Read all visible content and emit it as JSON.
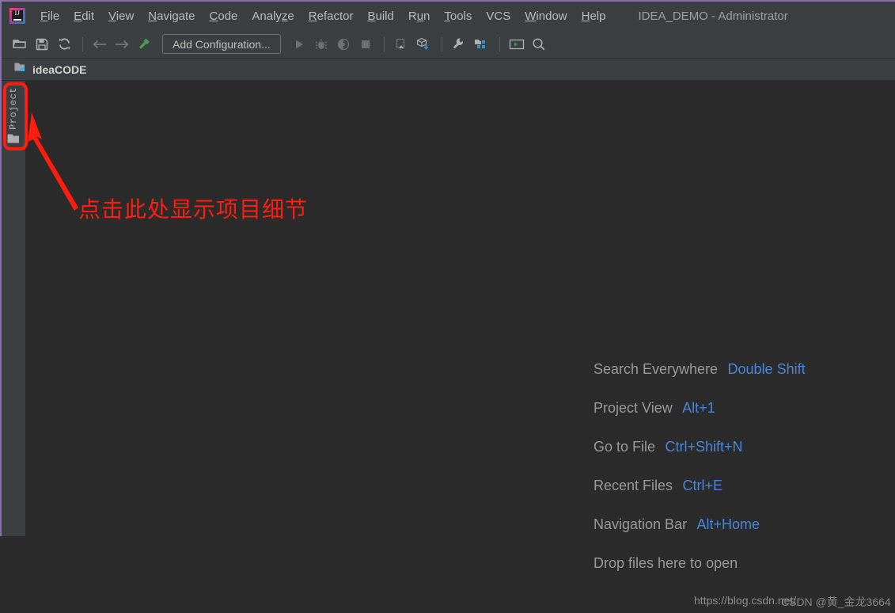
{
  "window": {
    "title": "IDEA_DEMO - Administrator",
    "logo_icon": "intellij-idea-logo"
  },
  "menubar": {
    "items": [
      {
        "label": "File",
        "mnemonic": "F"
      },
      {
        "label": "Edit",
        "mnemonic": "E"
      },
      {
        "label": "View",
        "mnemonic": "V"
      },
      {
        "label": "Navigate",
        "mnemonic": "N"
      },
      {
        "label": "Code",
        "mnemonic": "C"
      },
      {
        "label": "Analyze",
        "mnemonic": "z"
      },
      {
        "label": "Refactor",
        "mnemonic": "R"
      },
      {
        "label": "Build",
        "mnemonic": "B"
      },
      {
        "label": "Run",
        "mnemonic": "u"
      },
      {
        "label": "Tools",
        "mnemonic": "T"
      },
      {
        "label": "VCS",
        "mnemonic": ""
      },
      {
        "label": "Window",
        "mnemonic": "W"
      },
      {
        "label": "Help",
        "mnemonic": "H"
      }
    ]
  },
  "toolbar": {
    "add_configuration_label": "Add Configuration...",
    "buttons": [
      {
        "name": "open-folder-icon",
        "title": "Open"
      },
      {
        "name": "save-all-icon",
        "title": "Save All"
      },
      {
        "name": "sync-refresh-icon",
        "title": "Synchronize"
      },
      {
        "name": "back-arrow-icon",
        "title": "Back"
      },
      {
        "name": "forward-arrow-icon",
        "title": "Forward"
      },
      {
        "name": "build-hammer-icon",
        "title": "Build Project"
      },
      {
        "name": "run-play-icon",
        "title": "Run"
      },
      {
        "name": "debug-bug-icon",
        "title": "Debug"
      },
      {
        "name": "run-with-coverage-icon",
        "title": "Run with Coverage"
      },
      {
        "name": "stop-square-icon",
        "title": "Stop"
      },
      {
        "name": "update-project-icon",
        "title": "Update Project"
      },
      {
        "name": "commit-box-icon",
        "title": "Commit"
      },
      {
        "name": "settings-wrench-icon",
        "title": "Settings"
      },
      {
        "name": "project-structure-icon",
        "title": "Project Structure"
      },
      {
        "name": "terminal-window-icon",
        "title": "Terminal"
      },
      {
        "name": "search-magnifier-icon",
        "title": "Search Everywhere"
      }
    ]
  },
  "navbar": {
    "project_name": "ideaCODE",
    "folder_icon": "project-folder-icon"
  },
  "tool_stripe": {
    "project_tab_label": "Project",
    "project_tab_icon": "folder-icon"
  },
  "editor": {
    "hints": [
      {
        "label": "Search Everywhere",
        "key": "Double Shift"
      },
      {
        "label": "Project View",
        "key": "Alt+1"
      },
      {
        "label": "Go to File",
        "key": "Ctrl+Shift+N"
      },
      {
        "label": "Recent Files",
        "key": "Ctrl+E"
      },
      {
        "label": "Navigation Bar",
        "key": "Alt+Home"
      },
      {
        "label": "Drop files here to open",
        "key": ""
      }
    ]
  },
  "watermark": {
    "line_a": "https://blog.csdn.net/",
    "line_b": "CSDN @黄_金龙3664"
  },
  "annotation": {
    "text": "点击此处显示项目细节",
    "color": "#ff1d10",
    "highlight_target": "project-tool-window-tab"
  },
  "colors": {
    "chrome": "#3c3f41",
    "editor_bg": "#2b2b2b",
    "accent_purple": "#8a6fae",
    "hint_key_blue": "#4a86d8",
    "hint_label_gray": "#9a9a9a",
    "annotation_red": "#ff1d10"
  }
}
